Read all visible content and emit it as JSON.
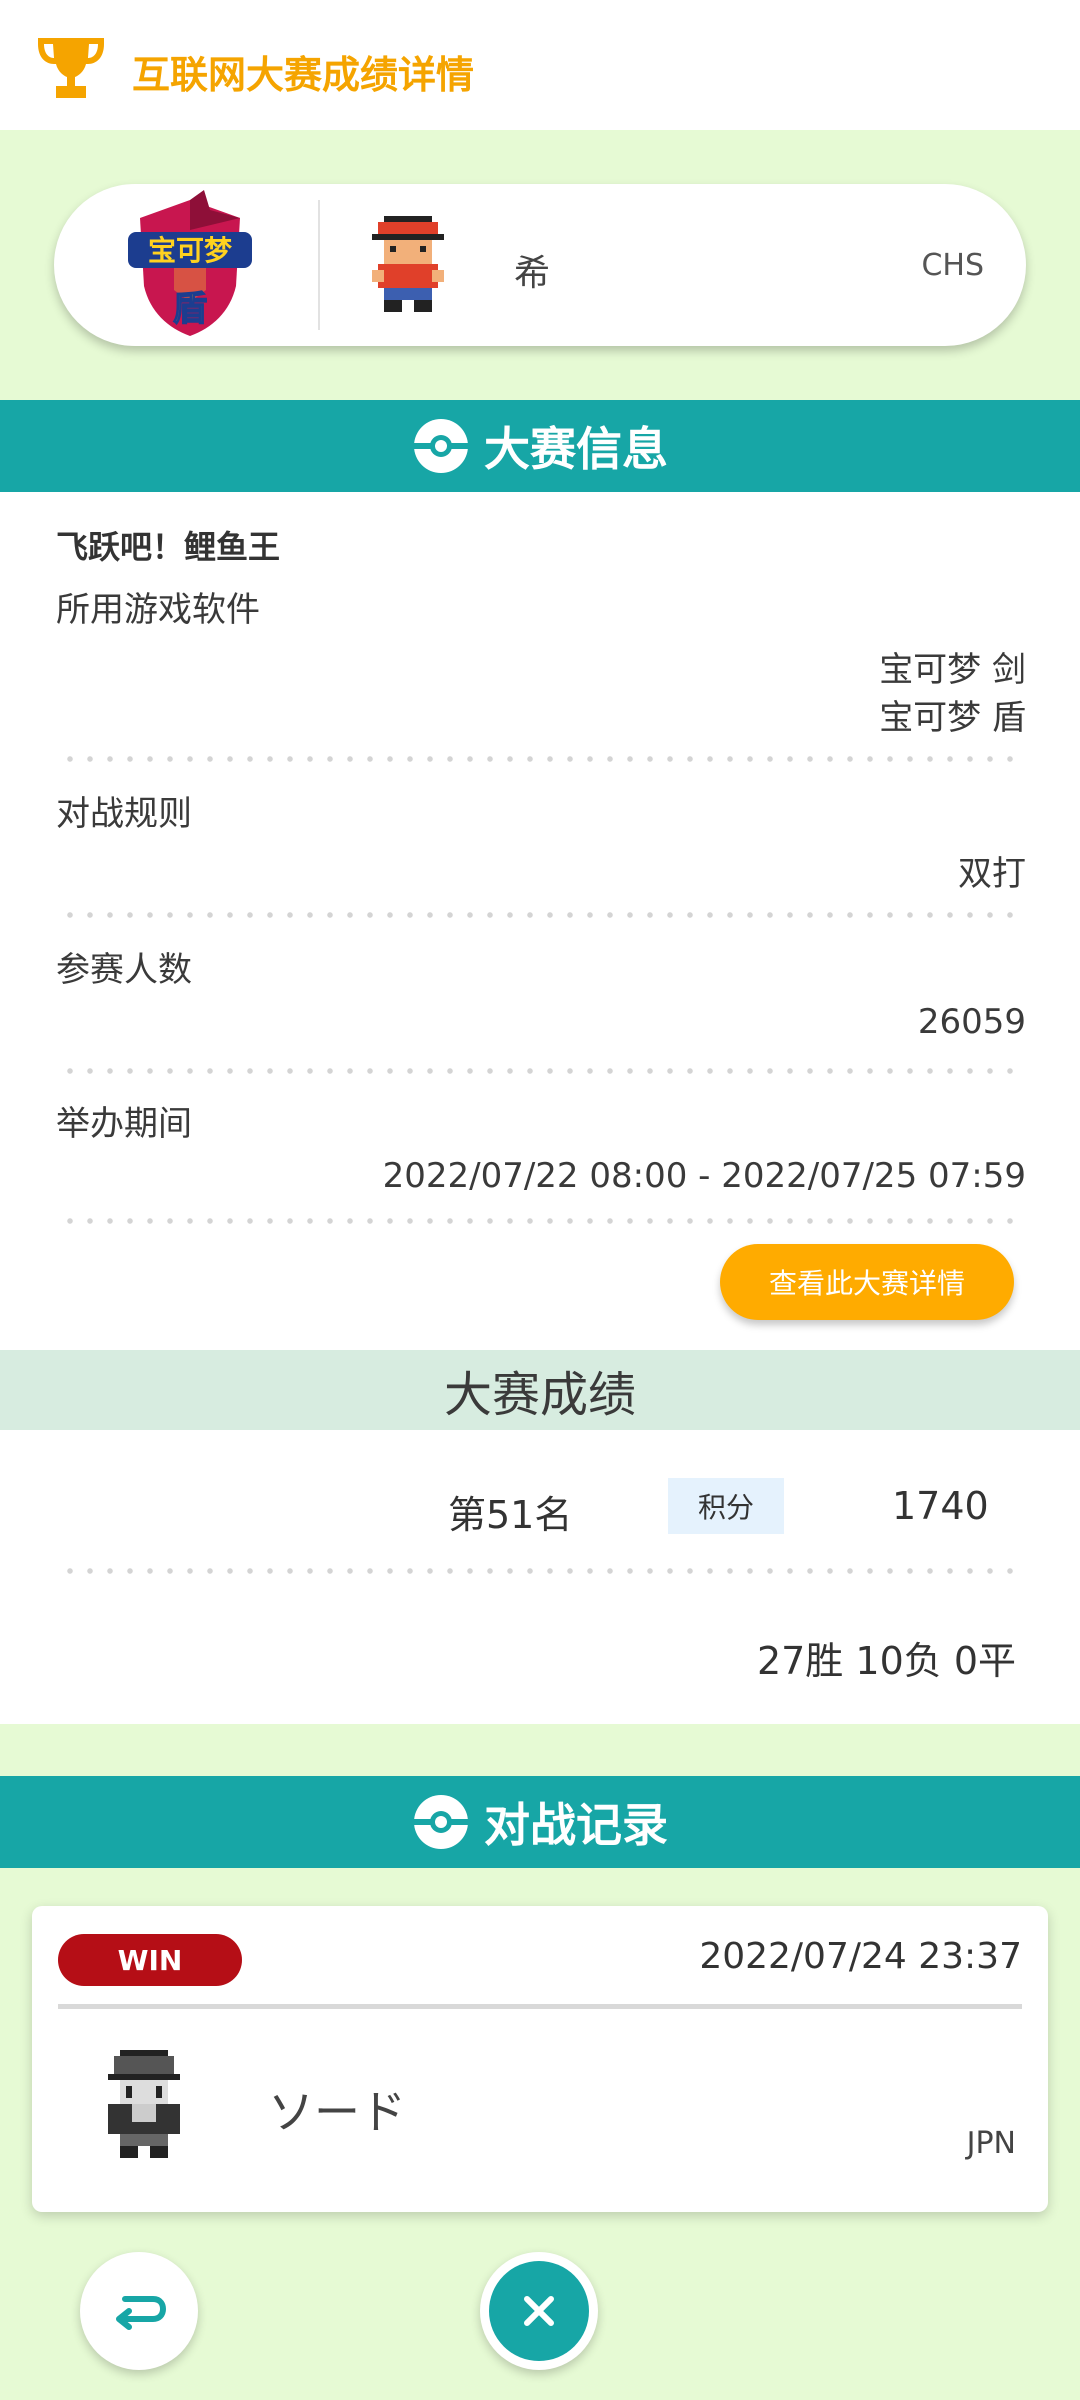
{
  "header": {
    "title": "互联网大赛成绩详情",
    "icon": "trophy-icon"
  },
  "player": {
    "game_logo_text_top": "宝可梦",
    "game_logo_text_bottom": "盾",
    "name": "希",
    "region": "CHS"
  },
  "info": {
    "title": "大赛信息",
    "event_name": "飞跃吧！鲤鱼王",
    "game_software_label": "所用游戏软件",
    "game_software": [
      "宝可梦 剑",
      "宝可梦 盾"
    ],
    "rule_label": "对战规则",
    "rule": "双打",
    "participants_label": "参赛人数",
    "participants": "26059",
    "period_label": "举办期间",
    "period": "2022/07/22 08:00 - 2022/07/25 07:59",
    "detail_button": "查看此大赛详情"
  },
  "results": {
    "title": "大赛成绩",
    "rank": "第51名",
    "points_label": "积分",
    "points": "1740",
    "record": "27胜 10负 0平"
  },
  "battles": {
    "title": "对战记录",
    "items": [
      {
        "result": "WIN",
        "date": "2022/07/24 23:37",
        "opponent": "ソード",
        "region": "JPN"
      }
    ]
  },
  "colors": {
    "accent": "#17a6a6",
    "header_text": "#f5a400",
    "button": "#ffab00",
    "win": "#b50e16",
    "background": "#e6fad4"
  }
}
